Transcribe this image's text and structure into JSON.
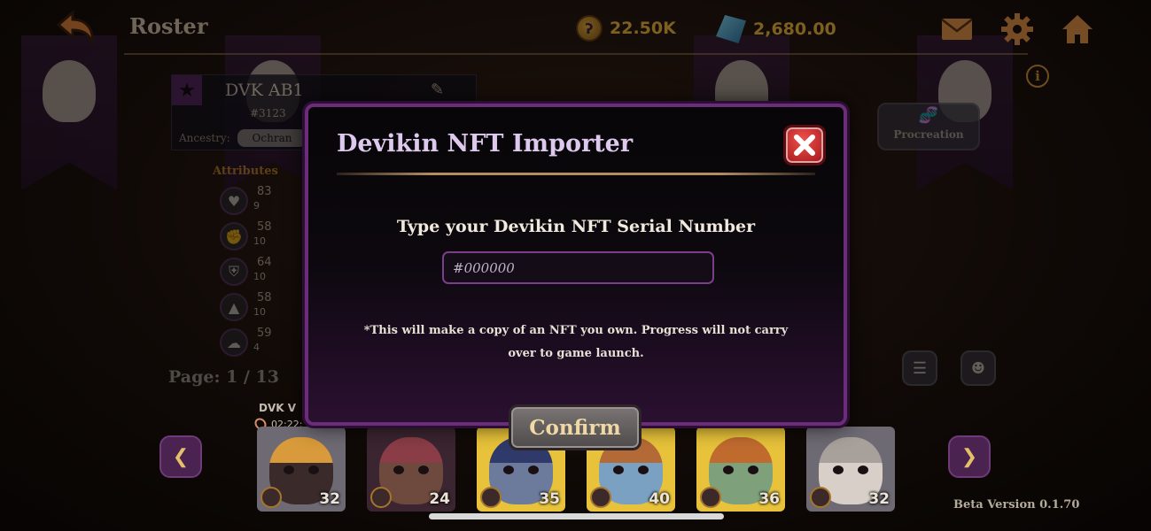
{
  "header": {
    "title": "Roster",
    "gold": "22.50K",
    "gems": "2,680.00"
  },
  "character": {
    "name": "DVK AB1",
    "serial": "#3123",
    "ancestry_label": "Ancestry:",
    "ancestry_value": "Ochran"
  },
  "attributes": {
    "title": "Attributes",
    "items": [
      {
        "icon": "heart-icon",
        "value": "83",
        "sub": "9"
      },
      {
        "icon": "fist-icon",
        "value": "58",
        "sub": "10"
      },
      {
        "icon": "shield-icon",
        "value": "64",
        "sub": "10"
      },
      {
        "icon": "boot-icon",
        "value": "58",
        "sub": "10"
      },
      {
        "icon": "brain-icon",
        "value": "59",
        "sub": "4"
      }
    ]
  },
  "page_indicator": "Page: 1 / 13",
  "procreation_label": "Procreation",
  "roster": {
    "first_label": "DVK V",
    "first_timer": "02:22:",
    "slots": [
      {
        "level": "32",
        "bg": "#6e6a74",
        "skin": "#3a2a2a",
        "hair": "#d89a3a"
      },
      {
        "level": "24",
        "bg": "#3a2530",
        "skin": "#6e4a3e",
        "hair": "#8a3d46"
      },
      {
        "level": "35",
        "bg": "#e7c23a",
        "skin": "#6c7a9c",
        "hair": "#2f3a6a"
      },
      {
        "level": "40",
        "bg": "#e7c23a",
        "skin": "#7aa0c2",
        "hair": "#b46a36"
      },
      {
        "level": "36",
        "bg": "#e7c23a",
        "skin": "#7ea07a",
        "hair": "#c06a2e"
      },
      {
        "level": "32",
        "bg": "#6e6a74",
        "skin": "#d8d0c8",
        "hair": "#a8a09a"
      }
    ]
  },
  "version": "Beta Version 0.1.70",
  "modal": {
    "title": "Devikin NFT Importer",
    "prompt": "Type your Devikin NFT Serial Number",
    "input_placeholder": "#000000",
    "disclaimer": "*This will make a copy of an NFT you own. Progress will not carry over to game launch.",
    "confirm_label": "Confirm"
  },
  "colors": {
    "accent_purple": "#6b2c7a",
    "close_red": "#c8232a",
    "gold": "#e3ad3a",
    "icon_orange": "#d68a40"
  }
}
